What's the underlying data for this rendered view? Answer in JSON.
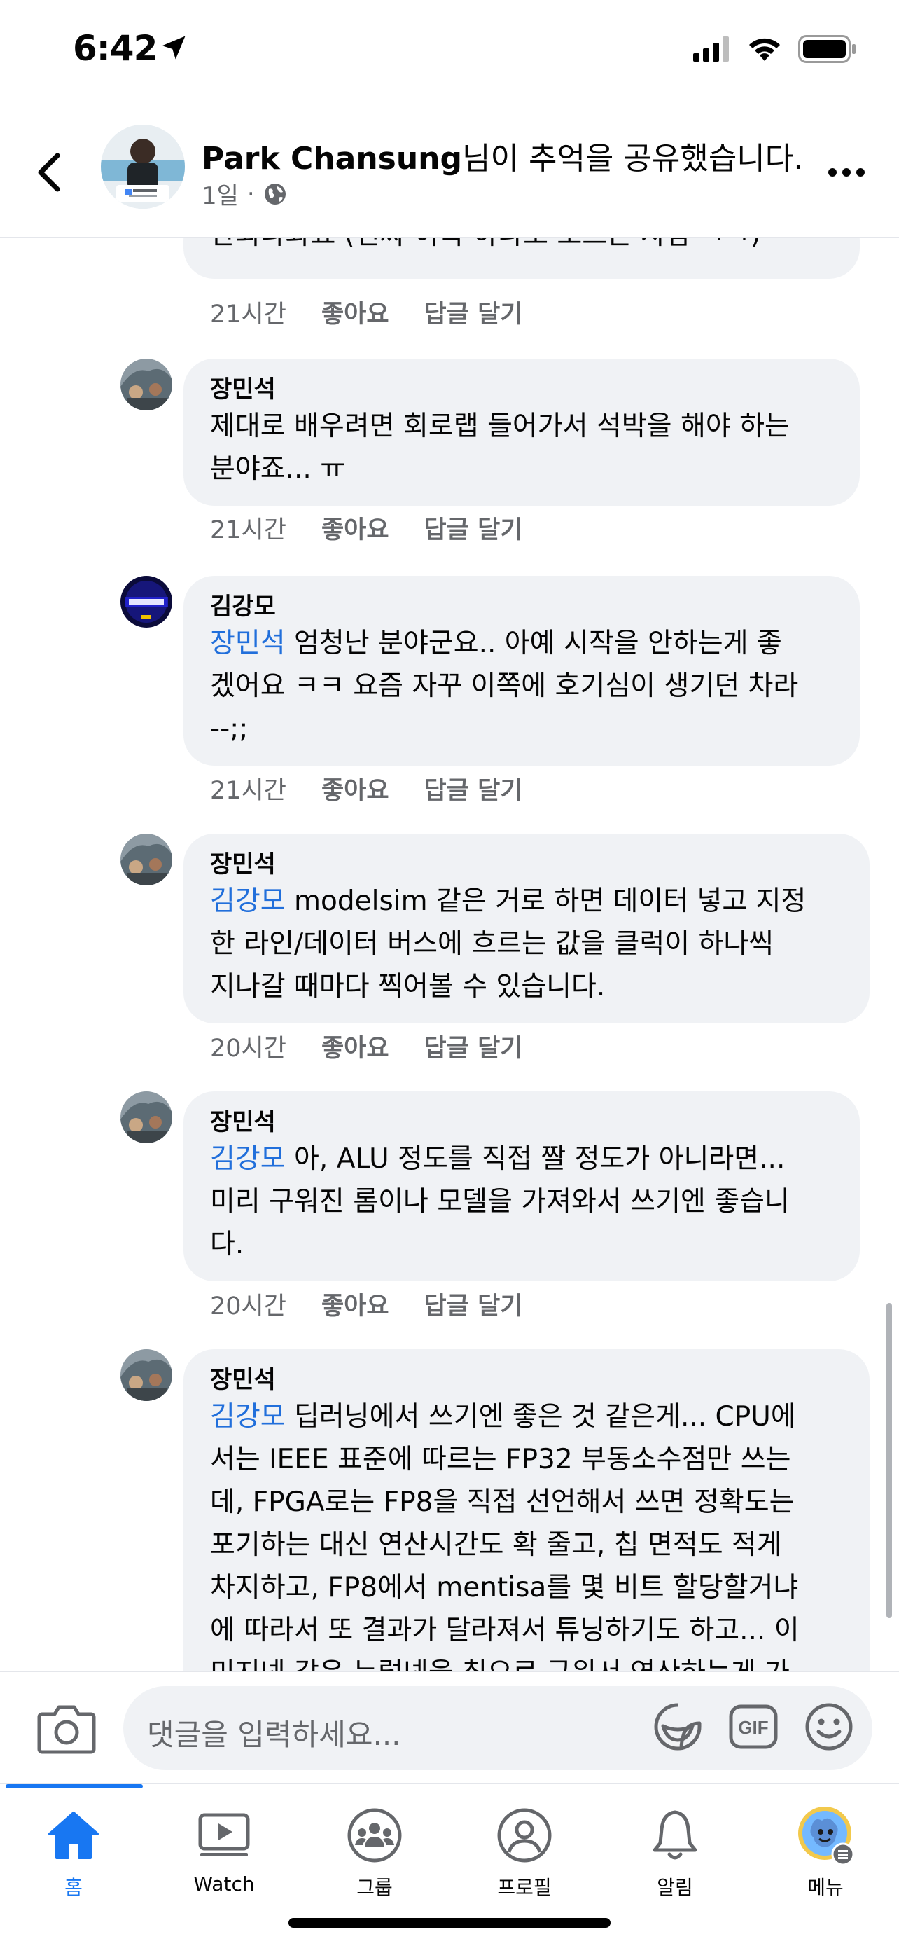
{
  "status_bar": {
    "time": "6:42"
  },
  "header": {
    "author": "Park Chansung",
    "action": "님이 추억을 공유했습니다.",
    "age": "1일",
    "privacy_icon": "globe-icon"
  },
  "comments": [
    {
      "author": "",
      "mention": "",
      "text": "안되나봐요 (진짜 이쪽 하나도 모르는 사람 ㅋㅋ)",
      "time": "21시간",
      "like": "좋아요",
      "reply": "답글 달기"
    },
    {
      "author": "장민석",
      "mention": "",
      "text": "제대로 배우려면 회로랩 들어가서 석박을 해야 하는\n분야죠... ㅠ",
      "time": "21시간",
      "like": "좋아요",
      "reply": "답글 달기"
    },
    {
      "author": "김강모",
      "mention": "장민석",
      "text": " 엄청난 분야군요.. 아예 시작을 안하는게 좋\n겠어요 ㅋㅋ 요즘 자꾸 이쪽에 호기심이 생기던 차라\n--;;",
      "time": "21시간",
      "like": "좋아요",
      "reply": "답글 달기"
    },
    {
      "author": "장민석",
      "mention": "김강모",
      "text": " modelsim 같은 거로 하면 데이터 넣고 지정\n한 라인/데이터 버스에 흐르는 값을 클럭이 하나씩\n지나갈 때마다 찍어볼 수 있습니다.",
      "time": "20시간",
      "like": "좋아요",
      "reply": "답글 달기"
    },
    {
      "author": "장민석",
      "mention": "김강모",
      "text": " 아, ALU 정도를 직접 짤 정도가 아니라면...\n미리 구워진 롬이나 모델을 가져와서 쓰기엔 좋습니\n다.",
      "time": "20시간",
      "like": "좋아요",
      "reply": "답글 달기"
    },
    {
      "author": "장민석",
      "mention": "김강모",
      "text": "  딥러닝에서 쓰기엔 좋은 것 같은게... CPU에\n서는 IEEE 표준에 따르는 FP32 부동소수점만 쓰는\n데, FPGA로는 FP8을 직접 선언해서 쓰면 정확도는\n포기하는 대신 연산시간도 확 줄고, 칩 면적도 적게\n차지하고, FP8에서 mentisa를 몇 비트 할당할거냐\n에 따라서 또 결과가 달라져서 튜닝하기도 하고... 이\n미지넷 같은 뉴럴넷을 칩으로 구워서 연산하는게 가",
      "time": "",
      "like": "",
      "reply": ""
    }
  ],
  "input": {
    "placeholder": "댓글을 입력하세요...",
    "gif_label": "GIF"
  },
  "tabs": [
    {
      "label": "홈",
      "icon": "home-icon",
      "active": true
    },
    {
      "label": "Watch",
      "icon": "video-icon",
      "active": false
    },
    {
      "label": "그룹",
      "icon": "groups-icon",
      "active": false
    },
    {
      "label": "프로필",
      "icon": "profile-icon",
      "active": false
    },
    {
      "label": "알림",
      "icon": "bell-icon",
      "active": false
    },
    {
      "label": "메뉴",
      "icon": "menu-avatar-icon",
      "active": false
    }
  ],
  "colors": {
    "accent": "#1877f2",
    "mention": "#216fdb",
    "bubble": "#f0f2f5",
    "secondary_text": "#65676b"
  }
}
